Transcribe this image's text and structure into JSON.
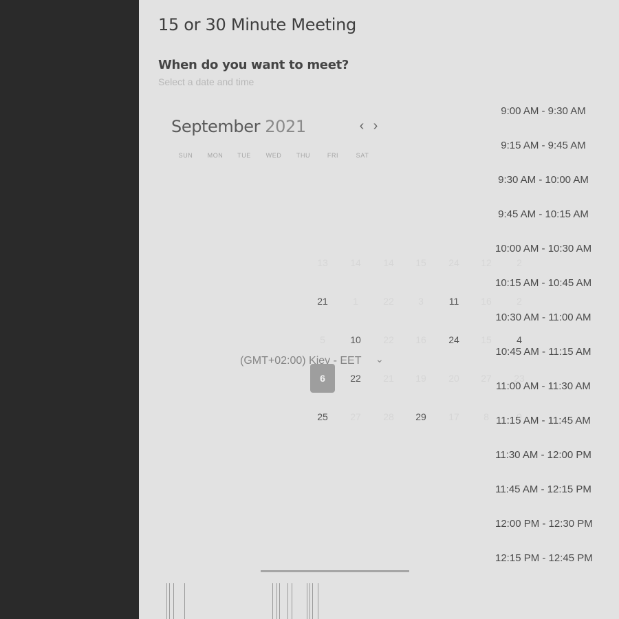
{
  "meeting": {
    "title": "15 or 30 Minute Meeting",
    "question": "When do you want to meet?",
    "subtitle": "Select a date and time"
  },
  "calendar": {
    "month": "September",
    "year": "2021",
    "prev_label": "‹",
    "next_label": "›",
    "weekdays": [
      "SUN",
      "MON",
      "TUE",
      "WED",
      "THU",
      "FRI",
      "SAT"
    ],
    "rows": [
      [
        "13",
        "14",
        "14",
        "15",
        "24",
        "12",
        "2"
      ],
      [
        "21",
        "1",
        "22",
        "3",
        "11",
        "16",
        "2"
      ],
      [
        "5",
        "10",
        "22",
        "16",
        "24",
        "15",
        "4"
      ],
      [
        "6",
        "22",
        "21",
        "19",
        "20",
        "27",
        "23"
      ],
      [
        "25",
        "27",
        "28",
        "29",
        "17",
        "8",
        "9"
      ]
    ],
    "selected_day": "6"
  },
  "timezone": {
    "label": "(GMT+02:00) Kiev - EET",
    "caret": "⌄"
  },
  "slots": [
    "9:00 AM - 9:30 AM",
    "9:15 AM - 9:45 AM",
    "9:30 AM - 10:00 AM",
    "9:45 AM - 10:15 AM",
    "10:00 AM - 10:30 AM",
    "10:15 AM - 10:45 AM",
    "10:30 AM - 11:00 AM",
    "10:45 AM - 11:15 AM",
    "11:00 AM - 11:30 AM",
    "11:15 AM - 11:45 AM",
    "11:30 AM - 12:00 PM",
    "11:45 AM - 12:15 PM",
    "12:00 PM - 12:30 PM",
    "12:15 PM - 12:45 PM"
  ],
  "colors": {
    "sidebar": "#2a2a2a",
    "background": "#e2e2e2",
    "selected_day": "#9e9e9e"
  }
}
